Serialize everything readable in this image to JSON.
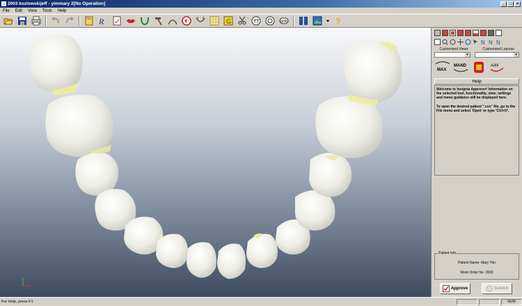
{
  "window": {
    "title": "2003 kozlowskijeff - yimmary 2[No Operation]",
    "buttons": {
      "minimize": "_",
      "maximize": "□",
      "close": "×"
    }
  },
  "menu": [
    "File",
    "Edit",
    "View",
    "Tools",
    "Help"
  ],
  "toolbar": {
    "icons": [
      "open-icon",
      "save-icon",
      "print-icon",
      "undo-icon",
      "redo-icon",
      "notebook-icon",
      "rx-icon",
      "form-icon",
      "lips-icon",
      "arch-icon",
      "hammer-icon",
      "curve-icon",
      "occlusion-icon",
      "measure-icon",
      "grid-icon",
      "gold-tooth-icon",
      "cut-icon",
      "tooth-id-icon",
      "tooth-outline-icon",
      "ipr-icon",
      "split-view-icon",
      "image-icon",
      "dropdown-icon",
      "help-icon"
    ]
  },
  "right_panel": {
    "customized_views_label": "Customized Views",
    "customized_layouts_label": "Customized Layouts",
    "max_button": "MAX",
    "mand_button": "MAND",
    "aw_button": "A/W",
    "help_title": "Help",
    "help_text_1": "Welcome to Insignia Approver! Information on the selected tool, functionality, view; settings and menu guidance will be displayed here.",
    "help_text_2": "To open the desired patient \".cvs\" file, go to the File menu and select 'Open' or type 'Ctrl+O'.",
    "patient_info_label": "Patient Info",
    "patient_name": "Patient Name: Mary Yim",
    "work_order": "Work Order No: 2003",
    "approve_button": "Approve",
    "submit_button": "Submit"
  },
  "status": {
    "text": "For Help, press F1",
    "num": "NUM"
  },
  "colors": {
    "title_bar": "#0a246a",
    "tooth": "#f2f1ea",
    "gum_line": "#eeeba0"
  }
}
